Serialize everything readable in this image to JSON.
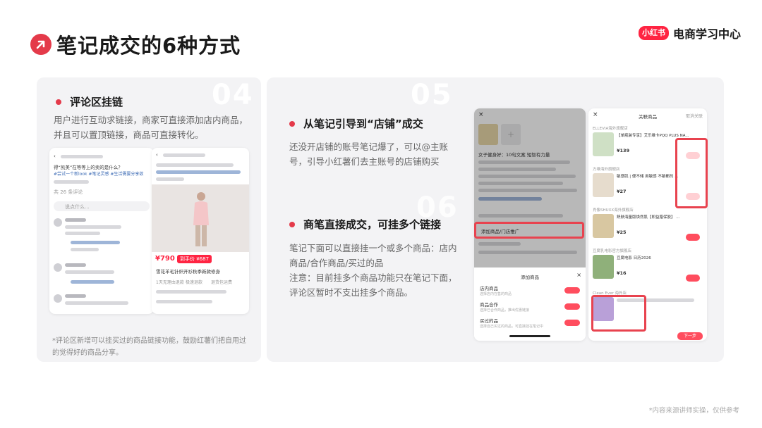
{
  "header": {
    "title": "笔记成交的6种方式",
    "brand_logo": "小红书",
    "brand_text": "电商学习中心"
  },
  "left_panel": {
    "number": "04",
    "title": "评论区挂链",
    "description": "用户进行互动求链接，商家可直接添加店内商品，并且可以置顶链接，商品可直接转化。",
    "footnote": "*评论区新增可以挂买过的商品链接功能，鼓励红薯们把自用过的觉得好的商品分享。",
    "mock": {
      "post_line1": "得“凯美”在等等上的卖的是什么？",
      "post_tags": "#尝试一个新look #笔记灵感 #生活需要分享欲",
      "comments_count": "共 26 条评论",
      "comment_placeholder": "说点什么...",
      "price": "¥790",
      "price_tag": "到手价 ¥687",
      "product_name": "雪花羊毛针织开衫秋季新款修身",
      "params": [
        "1天无理由退款",
        "极速退款",
        "退货包运费"
      ]
    }
  },
  "right_panel": {
    "number_top": "05",
    "number_bottom": "06",
    "section1_title": "从笔记引导到“店铺”成交",
    "section1_desc": "还没开店铺的账号笔记爆了，可以@主账号，引导小红薯们去主账号的店铺购买",
    "section2_title": "商笔直接成交，可挂多个链接",
    "section2_desc": "笔记下面可以直接挂一个或多个商品：店内商品/合作商品/买过的品\n注意：目前挂多个商品功能只在笔记下面，评论区暂时不支出挂多个商品。",
    "mock_left": {
      "note_title": "女子健身好：10句文案 短智有力量",
      "add_link_label": "添加商品/门店推广",
      "sheet_title": "添加商品",
      "sheet_rows": [
        {
          "title": "店内商品",
          "sub": "选择店内在售的商品"
        },
        {
          "title": "商品合作",
          "sub": "选择已合作商品，推出优惠链接"
        },
        {
          "title": "买过的品",
          "sub": "选择自己买过的商品，可直接挂在笔记中"
        }
      ]
    },
    "mock_right": {
      "header_title": "关联商品",
      "header_action": "取消关联",
      "products": [
        {
          "shop": "ELLEVIA海外旗舰店",
          "name": "【单瓶装专享】艾乐维卡PQQ PLUS NA...",
          "price": "¥139"
        },
        {
          "shop": "方维海外旗舰店",
          "name": "敏感肌 | 便不储 用敏感 不敏都的 ...",
          "price": "¥27"
        },
        {
          "shop": "肖像SHUXX海外旗舰店",
          "name": "舒肤海量版焕然肌【即益腊保胶】 ...",
          "price": "¥25"
        },
        {
          "shop": "豆腐乳电影官方旗舰店",
          "name": "豆腐电影 日历2026",
          "price": "¥16"
        },
        {
          "shop": "Clean Ever 海外店",
          "name": "",
          "price": ""
        }
      ],
      "next_button": "下一步"
    }
  },
  "source_note": "*内容来源讲师实操，仅供参考",
  "colors": {
    "accent": "#e43a4a",
    "brand": "#ff2442",
    "panel_bg": "#f3f3f5"
  }
}
